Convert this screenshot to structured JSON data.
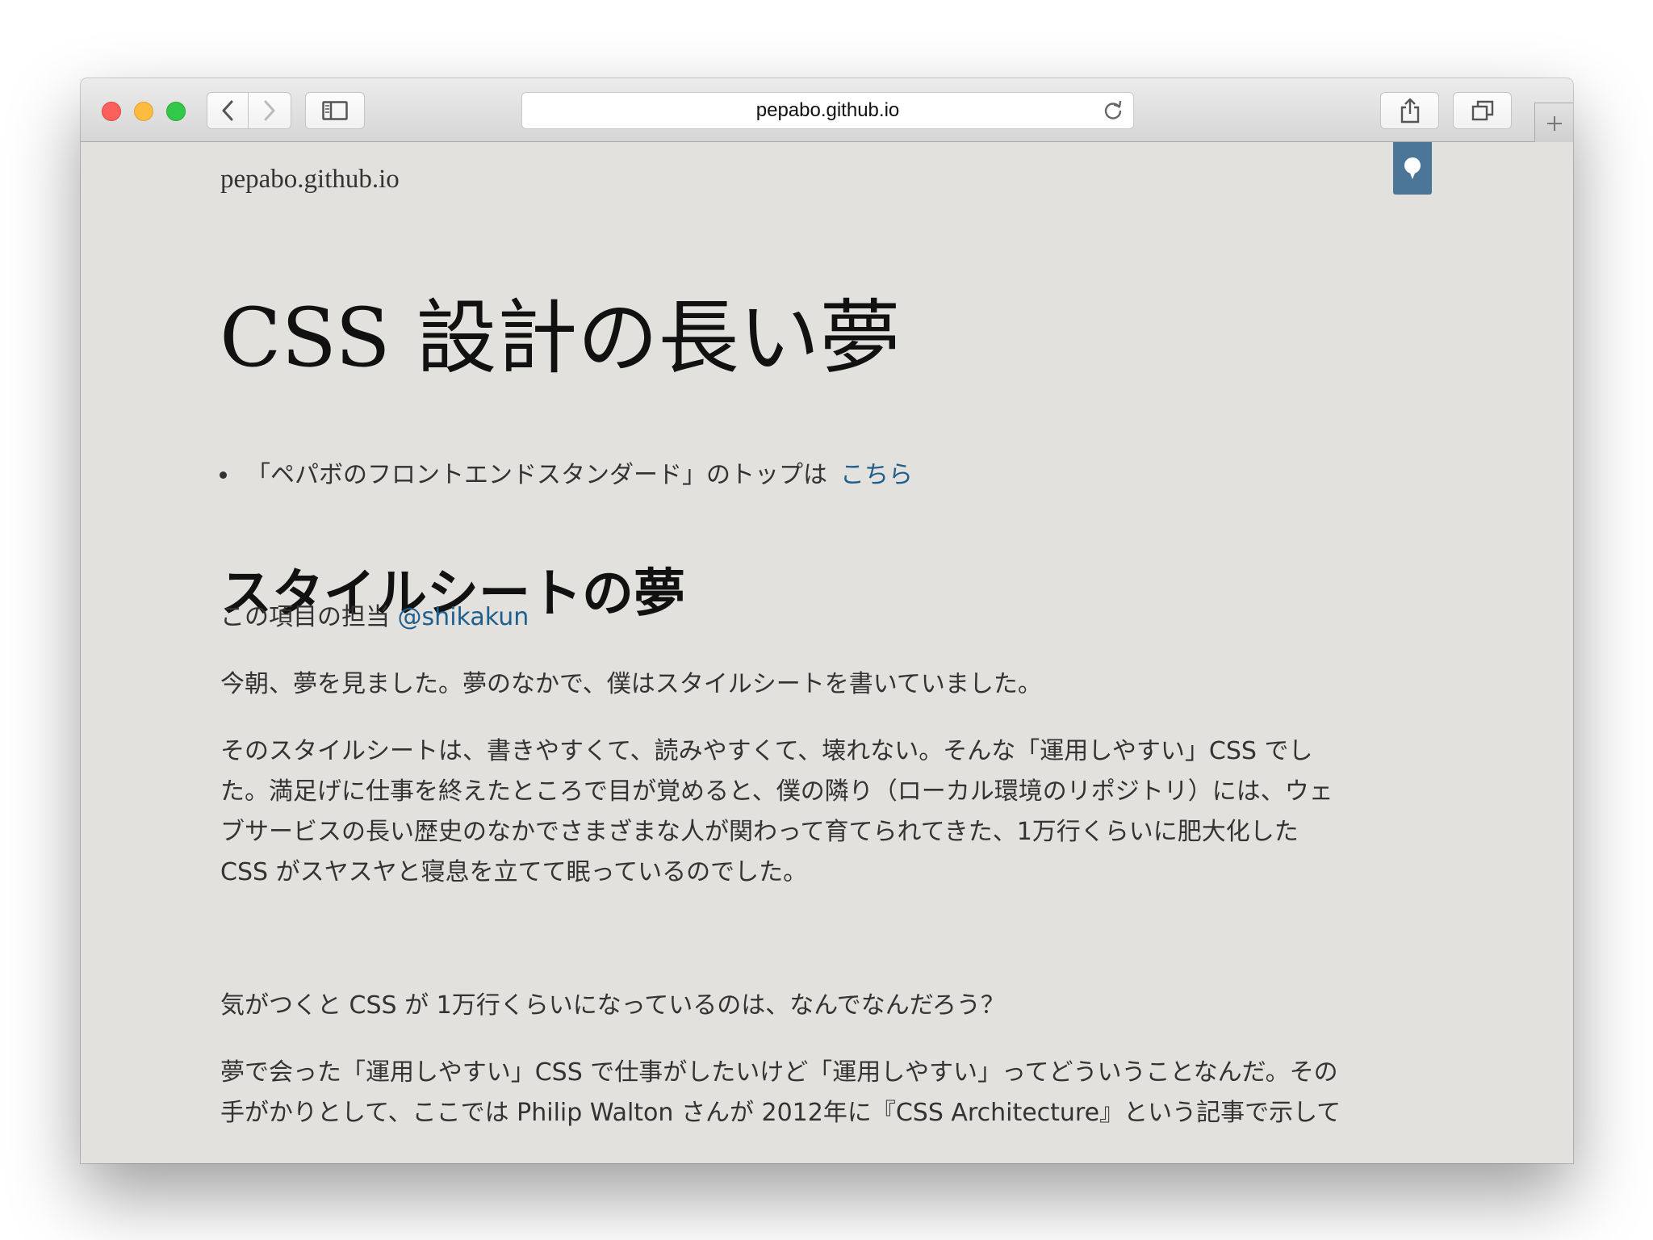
{
  "browser": {
    "url": "pepabo.github.io"
  },
  "page": {
    "site_name": "pepabo.github.io",
    "title": "CSS 設計の長い夢",
    "toc_bullet": {
      "text": "「ペパボのフロントエンドスタンダード」のトップは",
      "link": "こちら"
    },
    "section_heading": "スタイルシートの夢",
    "owner": {
      "prefix": "この項目の担当",
      "handle": "@shikakun"
    },
    "paragraphs": {
      "p1": "今朝、夢を見ました。夢のなかで、僕はスタイルシートを書いていました。",
      "p2_lines": [
        "そのスタイルシートは、書きやすくて、読みやすくて、壊れない。そんな「運用しやすい」CSS でし",
        "た。満足げに仕事を終えたところで目が覚めると、僕の隣り（ローカル環境のリポジトリ）には、ウェ",
        "ブサービスの長い歴史のなかでさまざまな人が関わって育てられてきた、1万行くらいに肥大化した",
        "CSS がスヤスヤと寝息を立てて眠っているのでした。"
      ],
      "p3": "気がつくと CSS が 1万行くらいになっているのは、なんでなんだろう？",
      "p4_lines": [
        "夢で会った「運用しやすい」CSS で仕事がしたいけど「運用しやすい」ってどういうことなんだ。その",
        "手がかりとして、ここでは Philip Walton さんが 2012年に『CSS Architecture』という記事で示して"
      ]
    }
  },
  "icons": {
    "back": "chevron-left-icon",
    "forward": "chevron-right-icon",
    "sidebar": "sidebar-icon",
    "reload": "reload-icon",
    "share": "share-icon",
    "tabs": "tabs-icon",
    "new_tab": "plus-icon",
    "hatena": "hatena-bookmark-icon"
  },
  "colors": {
    "page_bg": "#e3e1de",
    "link": "#1f5f8d",
    "hatena_bg": "#4b7698"
  }
}
